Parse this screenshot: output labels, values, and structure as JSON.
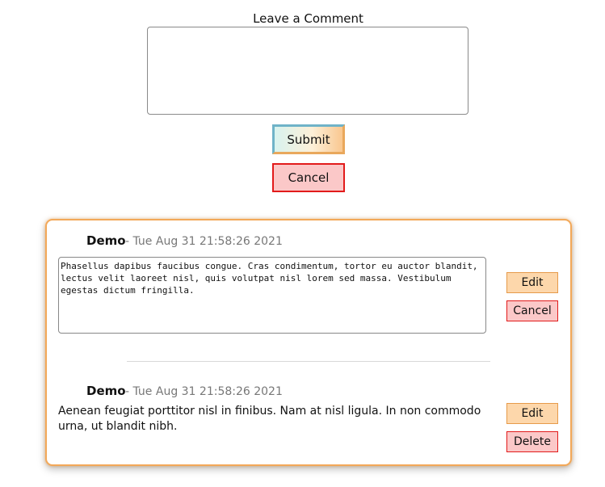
{
  "form": {
    "label": "Leave a Comment",
    "textarea_value": "",
    "submit_label": "Submit",
    "cancel_label": "Cancel"
  },
  "comments": [
    {
      "author": "Demo",
      "timestamp": "- Tue Aug 31 21:58:26 2021",
      "editing": true,
      "edit_text": "Phasellus dapibus faucibus congue. Cras condimentum, tortor eu auctor blandit, lectus velit laoreet nisl, quis volutpat nisl lorem sed massa. Vestibulum egestas dictum fringilla.",
      "edit_label": "Edit",
      "secondary_label": "Cancel"
    },
    {
      "author": "Demo",
      "timestamp": "- Tue Aug 31 21:58:26 2021",
      "editing": false,
      "body": "Aenean feugiat porttitor nisl in finibus. Nam at nisl ligula. In non commodo urna, ut blandit nibh.",
      "edit_label": "Edit",
      "secondary_label": "Delete"
    }
  ],
  "colors": {
    "card_border": "#f3a858",
    "edit_button_bg": "#fdd7ab",
    "danger_button_bg": "#fbc8c8",
    "danger_border": "#e21b1b"
  }
}
